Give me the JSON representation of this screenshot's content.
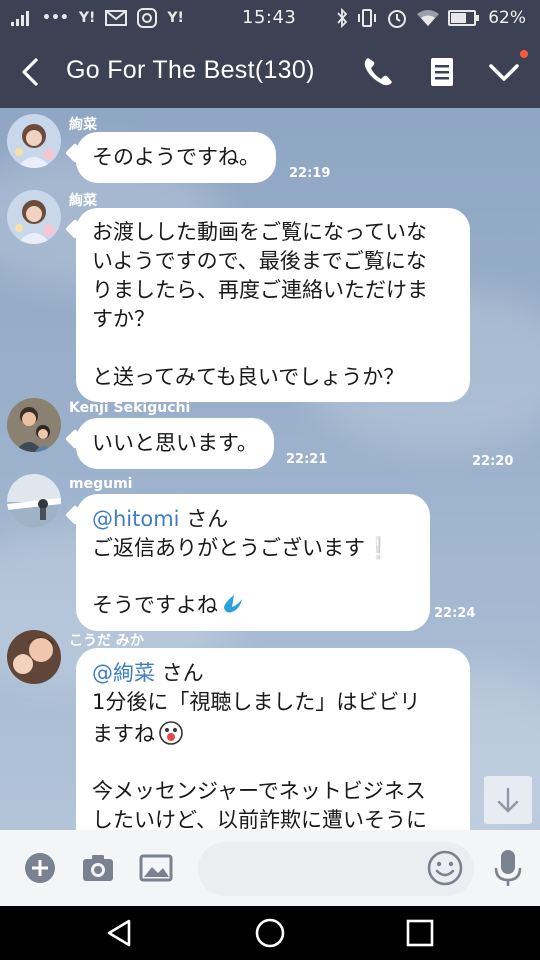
{
  "status_bar": {
    "carrier_glyphs": [
      "Y!",
      "Y!"
    ],
    "time": "15:43",
    "battery": "62%"
  },
  "header": {
    "title": "Go For The Best(130)",
    "icons": [
      "back-icon",
      "phone-icon",
      "note-icon",
      "check-icon"
    ],
    "accent": "#3c4253"
  },
  "messages": [
    {
      "sender": "絢菜",
      "text": "そのようですね。",
      "time": "22:19"
    },
    {
      "sender": "絢菜",
      "text": "お渡しした動画をご覧になっていな\nいようですので、最後までご覧にな\nりましたら、再度ご連絡いただけま\nすか？\n\nと送ってみても良いでしょうか？",
      "time": "22:20"
    },
    {
      "sender": "Kenji Sekiguchi",
      "text": "いいと思います。",
      "time": "22:21"
    },
    {
      "sender": "megumi",
      "mention": "@hitomi",
      "line1_rest": " さん",
      "line2": "ご返信ありがとうございます",
      "line2_mark": "❕",
      "line3": "そうですよね",
      "time": "22:24"
    },
    {
      "sender": "こうだ みか",
      "mention": "@絢菜",
      "line1_rest": " さん",
      "line2": "1分後に「視聴しました」はビビリ",
      "line3": "ますね",
      "line4": "今メッセンジャーでネットビジネス",
      "line5": "したいけど、以前詐欺に遭いそうに"
    }
  ],
  "input": {
    "placeholder": ""
  },
  "colors": {
    "bubble": "#ffffff",
    "mention": "#3f7ec3",
    "chat_bg": "#99afca"
  }
}
